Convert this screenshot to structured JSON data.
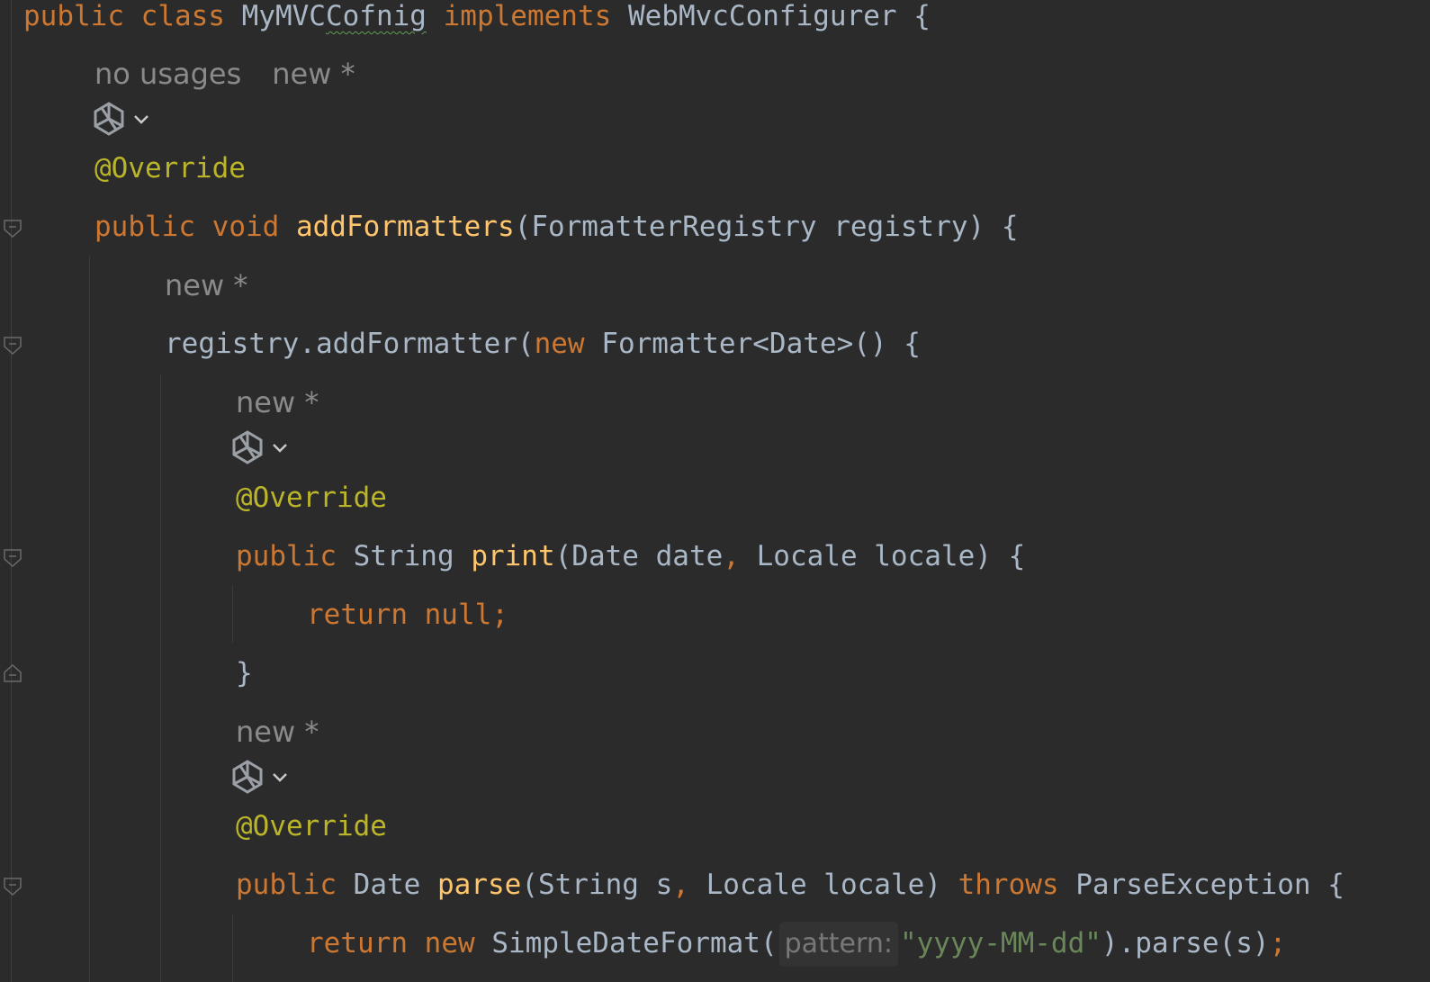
{
  "code": {
    "class_decl": {
      "kw_public": "public",
      "kw_class": "class",
      "name_part1": "MyMVC",
      "name_part2": "Cofnig",
      "kw_implements": "implements",
      "iface": "WebMvcConfigurer",
      "brace": "{"
    },
    "hint1": {
      "usages": "no usages",
      "author": "new *"
    },
    "annotation": "@Override",
    "method1": {
      "kw_public": "public",
      "kw_void": "void",
      "name": "addFormatters",
      "params": "(FormatterRegistry registry) {"
    },
    "hint2": {
      "author": "new *"
    },
    "call": {
      "target": "registry.addFormatter(",
      "kw_new": "new",
      "rest": "Formatter<Date>() {"
    },
    "hint3": {
      "author": "new *"
    },
    "print": {
      "kw_public": "public",
      "type": "String",
      "name": "print",
      "params_a": "(Date date",
      "comma": ",",
      "params_b": "Locale locale) {"
    },
    "return_null": "return null;",
    "close_brace": "}",
    "hint4": {
      "author": "new *"
    },
    "parse": {
      "kw_public": "public",
      "type": "Date",
      "name": "parse",
      "params_a": "(String s",
      "comma": ",",
      "params_b": "Locale locale)",
      "kw_throws": "throws",
      "exception": "ParseException {"
    },
    "return_parse": {
      "kw_return": "return",
      "kw_new": "new",
      "call": "SimpleDateFormat(",
      "param_hint": "pattern:",
      "string": "\"yyyy-MM-dd\"",
      "rest": ").parse(s)",
      "semi": ";"
    }
  },
  "icons": {
    "ai": "ai-assistant-icon",
    "chevron": "chevron-down-icon",
    "fold": "fold-marker-icon"
  },
  "colors": {
    "background": "#2b2b2b",
    "keyword": "#cc7832",
    "annotation": "#bbb529",
    "method": "#ffc66d",
    "string": "#6a8759",
    "text": "#a9b7c6",
    "hint": "#8a8a8a"
  }
}
